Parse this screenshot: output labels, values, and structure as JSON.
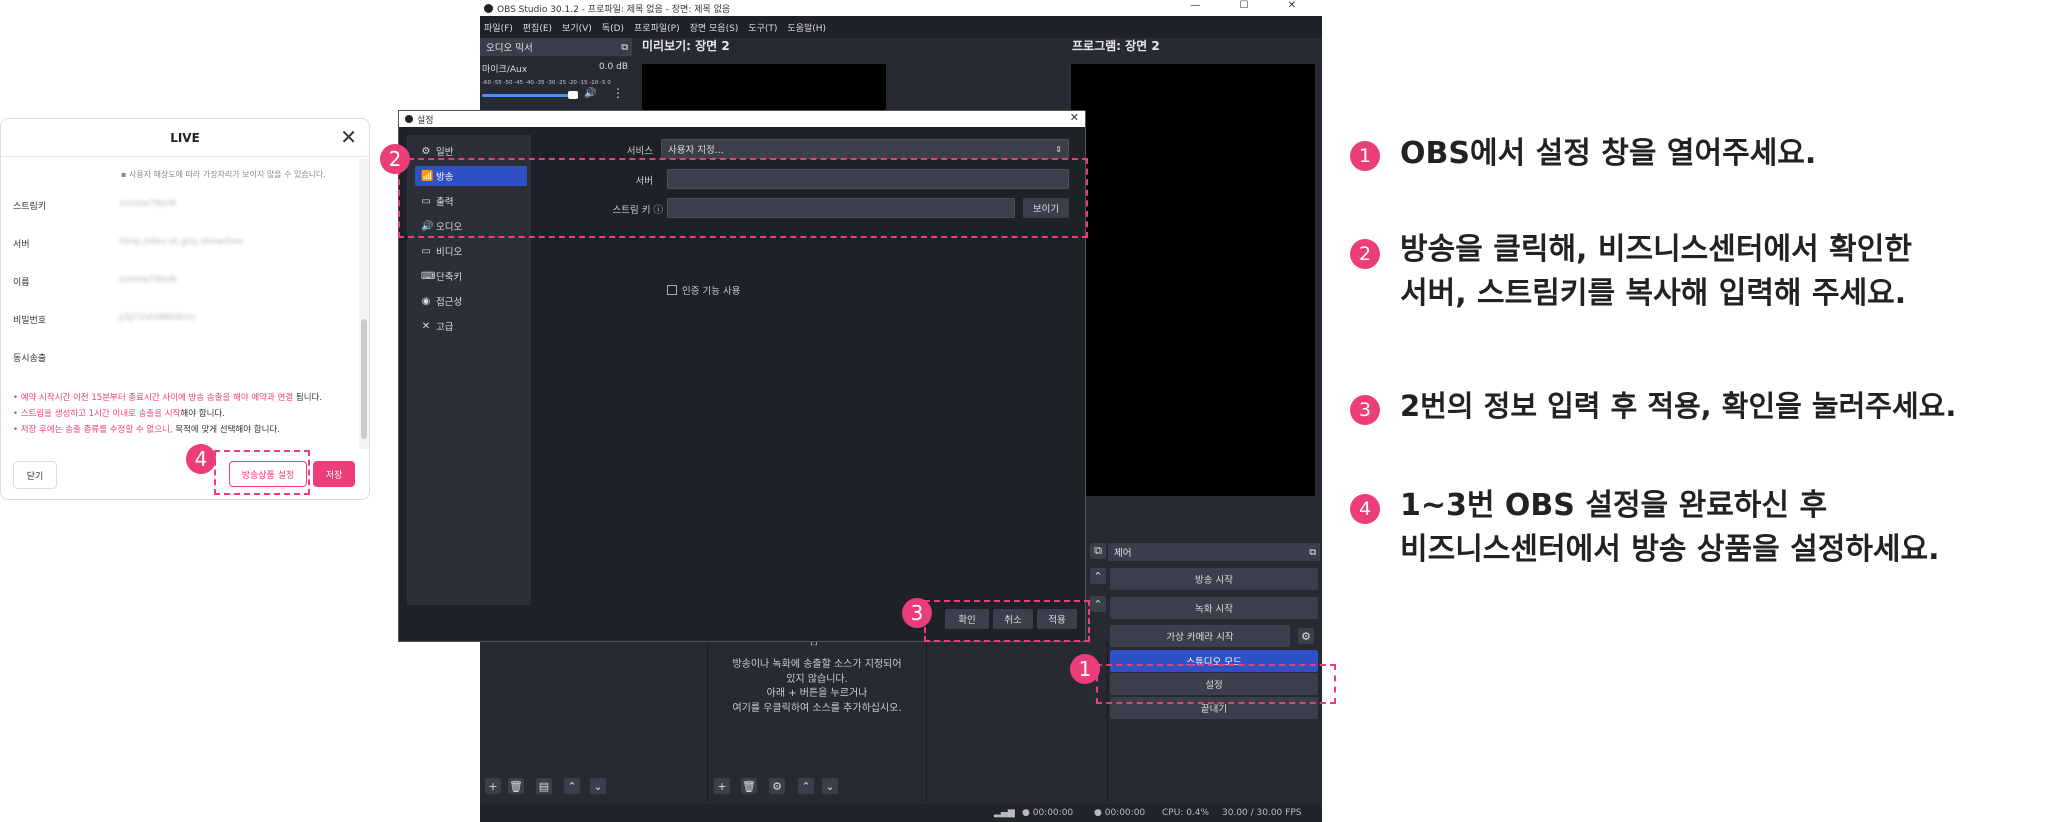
{
  "live": {
    "title": "LIVE",
    "note": "사용자 해상도에 따라 가장자리가 보이지 않을 수 있습니다.",
    "rows": [
      {
        "label": "스트림키",
        "value": "xmmw78srlk"
      },
      {
        "label": "서버",
        "value": "rtmp://dev-st.grip.show/live"
      },
      {
        "label": "이름",
        "value": "xmmw78srlk"
      },
      {
        "label": "비밀번호",
        "value": "p5J72sh9M8WnU"
      },
      {
        "label": "동시송출",
        "value": ""
      }
    ],
    "warnings": [
      {
        "text": "예약 시작시간 이전 15분부터 종료시간 사이에 방송 송출을 해야 예약과 연결",
        "tail": " 됩니다."
      },
      {
        "text": "스트림을 생성하고 1시간 이내로 송출을 시작",
        "tail": "해야 합니다."
      },
      {
        "text": "저장 후에는 송출 종류를 수정할 수 없으니,",
        "tail": " 목적에 맞게 선택해야 합니다."
      }
    ],
    "close_label": "닫기",
    "product_label": "방송상품 설정",
    "save_label": "저장"
  },
  "obs": {
    "window_title": "OBS Studio 30.1.2 - 프로파일: 제목 없음 - 장면: 제목 없음",
    "window_controls": "— ☐ ✕",
    "menu": [
      "파일(F)",
      "편집(E)",
      "보기(V)",
      "독(D)",
      "프로파일(P)",
      "장면 모음(S)",
      "도구(T)",
      "도움말(H)"
    ],
    "audio_mixer": "오디오 믹서",
    "mic_label": "마이크/Aux",
    "mic_db": "0.0 dB",
    "meter_scale": "-60 -55 -50 -45 -40 -35 -30 -25 -20 -15 -10 -5 0",
    "preview_label": "미리보기: 장면 2",
    "program_label": "프로그램: 장면 2",
    "control_title": "제어",
    "controls": [
      "방송 시작",
      "녹화 시작",
      "가상 카메라 시작",
      "스튜디오 모드",
      "설정",
      "끝내기"
    ],
    "sources_empty": [
      "방송이나 녹화에 송출할 소스가 지정되어",
      "있지 않습니다.",
      "아래 + 버튼을 누르거나",
      "여기를 우클릭하여 소스를 추가하십시오."
    ],
    "status": {
      "t1": "00:00:00",
      "t2": "00:00:00",
      "cpu": "CPU: 0.4%",
      "fps": "30.00 / 30.00 FPS"
    }
  },
  "settings": {
    "title": "설정",
    "nav": [
      "일반",
      "방송",
      "출력",
      "오디오",
      "비디오",
      "단축키",
      "접근성",
      "고급"
    ],
    "service_label": "서비스",
    "service_value": "사용자 지정...",
    "server_label": "서버",
    "key_label": "스트림 키",
    "show_label": "보이기",
    "auth_label": "인증 기능 사용",
    "ok": "확인",
    "cancel": "취소",
    "apply": "적용"
  },
  "badges": [
    "1",
    "2",
    "3",
    "4"
  ],
  "instructions": [
    {
      "num": "1",
      "lines": [
        "OBS에서 설정 창을 열어주세요."
      ]
    },
    {
      "num": "2",
      "lines": [
        "방송을 클릭해, 비즈니스센터에서 확인한",
        "서버, 스트림키를 복사해 입력해 주세요."
      ]
    },
    {
      "num": "3",
      "lines": [
        "2번의 정보 입력 후 적용, 확인을 눌러주세요."
      ]
    },
    {
      "num": "4",
      "lines": [
        "1~3번 OBS 설정을 완료하신 후",
        "비즈니스센터에서 방송 상품을 설정하세요."
      ]
    }
  ],
  "colors": {
    "accent": "#ea3d7a",
    "obs_bg": "#272a33",
    "obs_selected": "#2e51c6"
  }
}
